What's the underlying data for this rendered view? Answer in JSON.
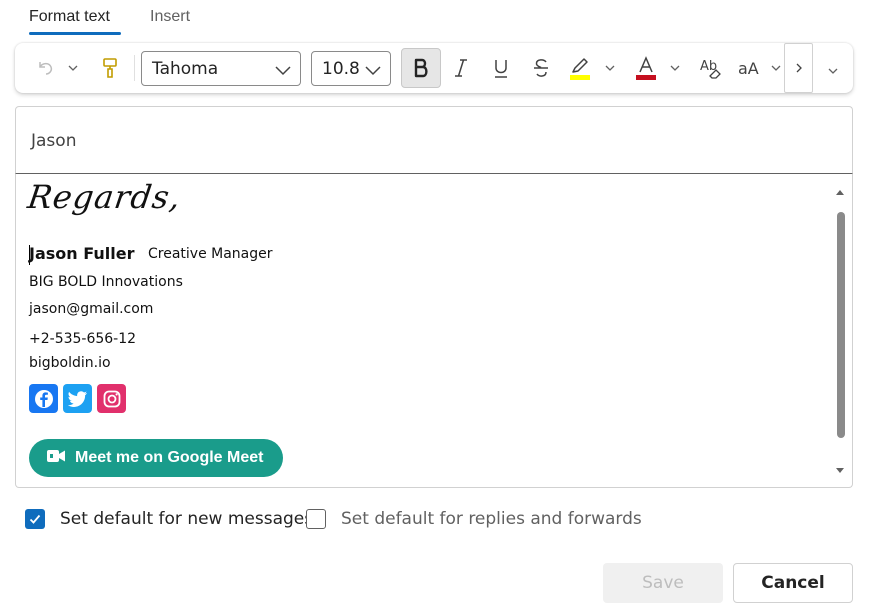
{
  "tabs": [
    {
      "label": "Format text",
      "active": true
    },
    {
      "label": "Insert",
      "active": false
    }
  ],
  "toolbar": {
    "font_family": "Tahoma",
    "font_size": "10.8",
    "icons": [
      "undo-icon",
      "chevron-down-icon",
      "format-painter-icon",
      "bold-icon",
      "italic-icon",
      "underline-icon",
      "strikethrough-icon",
      "highlight-icon",
      "font-color-icon",
      "clear-formatting-icon",
      "change-case-icon",
      "chevron-right-icon"
    ],
    "highlight_color": "#ffff00",
    "font_color": "#c50f1f",
    "bold_active": true
  },
  "signature_name": "Jason",
  "signature": {
    "closing": "Regards,",
    "name": "Jason Fuller",
    "title": "Creative Manager",
    "company": "BIG BOLD Innovations",
    "email": "jason@gmail.com",
    "phone": "+2-535-656-12",
    "website": "bigboldin.io",
    "socials": [
      {
        "icon": "facebook-icon",
        "color": "#1877f2"
      },
      {
        "icon": "twitter-icon",
        "color": "#1da1f2"
      },
      {
        "icon": "instagram-icon",
        "color": "#e1306c"
      }
    ],
    "meet_button": "Meet me on Google Meet",
    "meet_color": "#1a9c8b"
  },
  "options": {
    "default_new": {
      "label": "Set default for new messages",
      "checked": true
    },
    "default_replies": {
      "label": "Set default for replies and forwards",
      "checked": false
    }
  },
  "buttons": {
    "save": "Save",
    "cancel": "Cancel"
  },
  "accent_color": "#0f6cbd"
}
